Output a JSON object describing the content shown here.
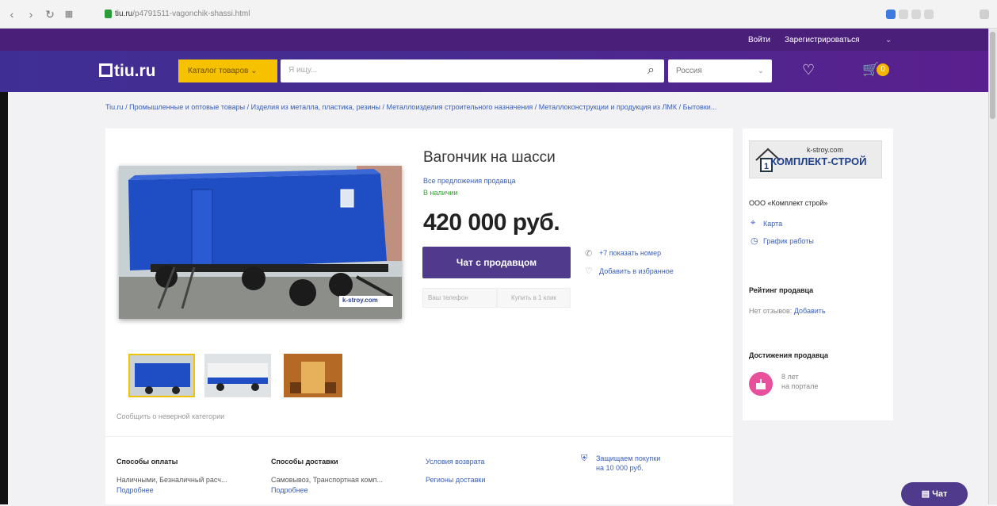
{
  "browser": {
    "url_domain": "tiu.ru",
    "url_rest": "/p4791511-vagonchik-shassi.html"
  },
  "header": {
    "login": "Войти",
    "register": "Зарегистрироваться",
    "logo": "tiu.ru",
    "catalog_btn": "Каталог товаров",
    "search_placeholder": "Я ищу...",
    "region": "Россия",
    "cart_count": "0"
  },
  "breadcrumb": "Tiu.ru / Промышленные и оптовые товары / Изделия из металла, пластика, резины / Металлоизделия строительного назначения / Металлоконструкции и продукция из ЛМК / Бытовки...",
  "product": {
    "title": "Вагончик на шасси",
    "all_offers": "Все предложения продавца",
    "stock": "В наличии",
    "price": "420 000 руб.",
    "chat_btn": "Чат с продавцом",
    "show_phone": "+7 показать номер",
    "add_favorites": "Добавить в избранное",
    "phone_placeholder": "Ваш телефон",
    "buy_one_click": "Купить в 1 клик",
    "watermark": "k-stroy.com",
    "report": "Сообщить о неверной категории"
  },
  "footer_info": {
    "payment_title": "Способы оплаты",
    "payment_text": "Наличными, Безналичный расч...",
    "payment_more": "Подробнее",
    "delivery_title": "Способы доставки",
    "delivery_text": "Самовывоз, Транспортная комп...",
    "delivery_more": "Подробнее",
    "return_terms": "Условия возврата",
    "delivery_regions": "Регионы доставки",
    "protect_line1": "Защищаем покупки",
    "protect_line2": "на 10 000 руб."
  },
  "seller": {
    "logo_site": "k-stroy.com",
    "logo_name": "КОМПЛЕКТ-СТРОЙ",
    "name": "ООО «Комплект строй»",
    "map_link": "Карта",
    "schedule_link": "График работы",
    "rating_title": "Рейтинг продавца",
    "no_reviews": "Нет отзывов:",
    "add_review": "Добавить",
    "achievements_title": "Достижения продавца",
    "ach_years": "8 лет",
    "ach_on_portal": "на портале"
  },
  "chat_float": "Чат",
  "colors": {
    "header_purple": "#4a2a8e",
    "catalog_yellow": "#f6c200",
    "chat_button": "#4f3a8c",
    "link_blue": "#3a5fb8",
    "stock_green": "#3aa03a"
  }
}
